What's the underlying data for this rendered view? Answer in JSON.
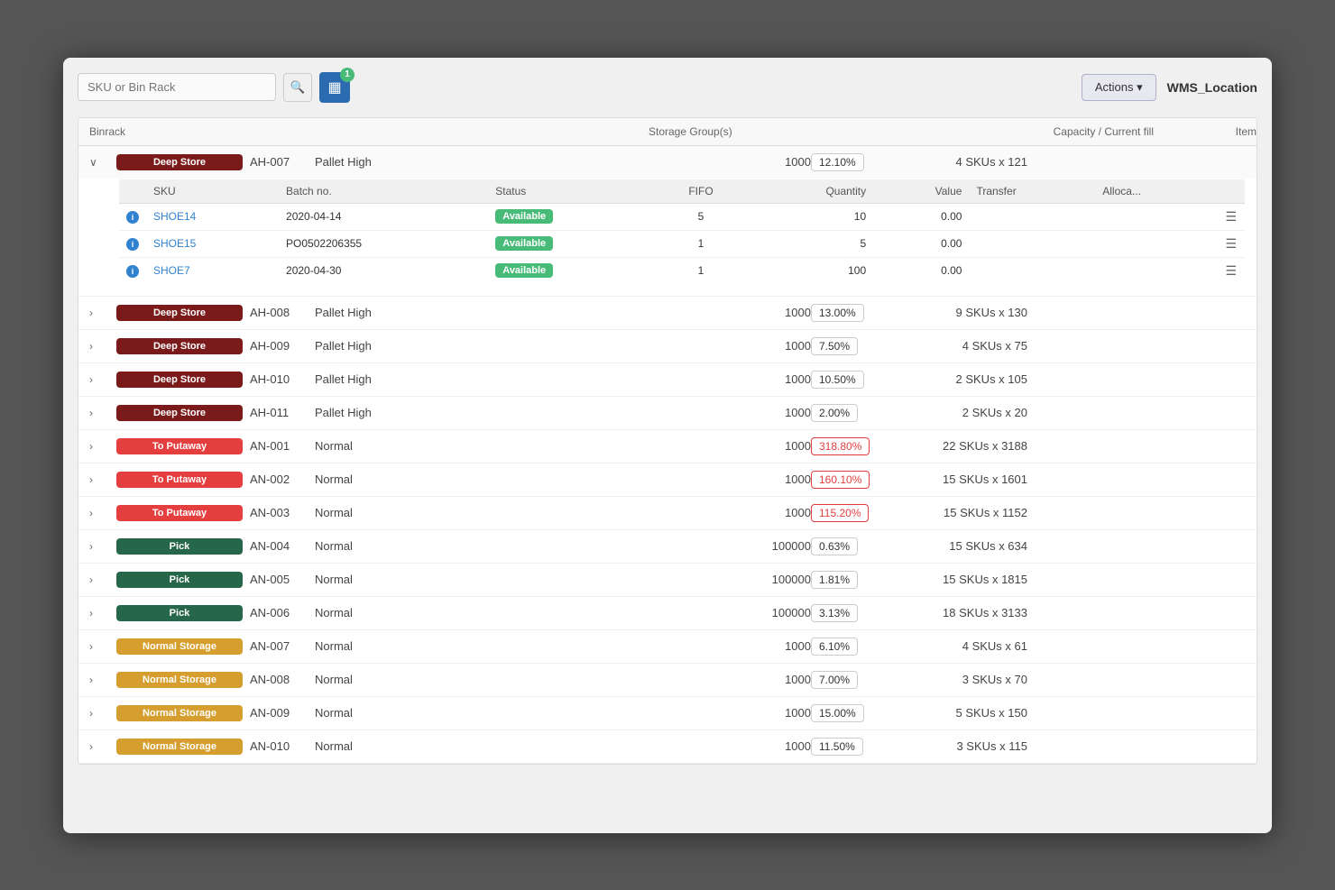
{
  "toolbar": {
    "search_placeholder": "SKU or Bin Rack",
    "filter_badge": "1",
    "actions_label": "Actions ▾",
    "wms_label": "WMS_Location"
  },
  "table": {
    "headers": {
      "binrack": "Binrack",
      "storage_groups": "Storage Group(s)",
      "capacity": "Capacity / Current fill",
      "items": "Items"
    },
    "sub_headers": {
      "sku": "SKU",
      "batch": "Batch no.",
      "status": "Status",
      "fifo": "FIFO",
      "quantity": "Quantity",
      "value": "Value",
      "transfer": "Transfer",
      "alloca": "Alloca..."
    }
  },
  "rows": [
    {
      "expanded": true,
      "tag": "Deep Store",
      "tag_type": "deep",
      "id": "AH-007",
      "storage_group": "Pallet High",
      "capacity": 1000,
      "fill": "12.10%",
      "fill_over": false,
      "items": "4 SKUs x 121",
      "sub_rows": [
        {
          "sku": "SHOE14",
          "batch": "2020-04-14",
          "status": "Available",
          "fifo": 5,
          "quantity": 10,
          "value": "0.00"
        },
        {
          "sku": "SHOE15",
          "batch": "PO0502206355",
          "status": "Available",
          "fifo": 1,
          "quantity": 5,
          "value": "0.00"
        },
        {
          "sku": "SHOE7",
          "batch": "2020-04-30",
          "status": "Available",
          "fifo": 1,
          "quantity": 100,
          "value": "0.00"
        }
      ]
    },
    {
      "expanded": false,
      "tag": "Deep Store",
      "tag_type": "deep",
      "id": "AH-008",
      "storage_group": "Pallet High",
      "capacity": 1000,
      "fill": "13.00%",
      "fill_over": false,
      "items": "9 SKUs x 130"
    },
    {
      "expanded": false,
      "tag": "Deep Store",
      "tag_type": "deep",
      "id": "AH-009",
      "storage_group": "Pallet High",
      "capacity": 1000,
      "fill": "7.50%",
      "fill_over": false,
      "items": "4 SKUs x 75"
    },
    {
      "expanded": false,
      "tag": "Deep Store",
      "tag_type": "deep",
      "id": "AH-010",
      "storage_group": "Pallet High",
      "capacity": 1000,
      "fill": "10.50%",
      "fill_over": false,
      "items": "2 SKUs x 105"
    },
    {
      "expanded": false,
      "tag": "Deep Store",
      "tag_type": "deep",
      "id": "AH-011",
      "storage_group": "Pallet High",
      "capacity": 1000,
      "fill": "2.00%",
      "fill_over": false,
      "items": "2 SKUs x 20"
    },
    {
      "expanded": false,
      "tag": "To Putaway",
      "tag_type": "putaway",
      "id": "AN-001",
      "storage_group": "Normal",
      "capacity": 1000,
      "fill": "318.80%",
      "fill_over": true,
      "items": "22 SKUs x 3188"
    },
    {
      "expanded": false,
      "tag": "To Putaway",
      "tag_type": "putaway",
      "id": "AN-002",
      "storage_group": "Normal",
      "capacity": 1000,
      "fill": "160.10%",
      "fill_over": true,
      "items": "15 SKUs x 1601"
    },
    {
      "expanded": false,
      "tag": "To Putaway",
      "tag_type": "putaway",
      "id": "AN-003",
      "storage_group": "Normal",
      "capacity": 1000,
      "fill": "115.20%",
      "fill_over": true,
      "items": "15 SKUs x 1152"
    },
    {
      "expanded": false,
      "tag": "Pick",
      "tag_type": "pick",
      "id": "AN-004",
      "storage_group": "Normal",
      "capacity": 100000,
      "fill": "0.63%",
      "fill_over": false,
      "items": "15 SKUs x 634"
    },
    {
      "expanded": false,
      "tag": "Pick",
      "tag_type": "pick",
      "id": "AN-005",
      "storage_group": "Normal",
      "capacity": 100000,
      "fill": "1.81%",
      "fill_over": false,
      "items": "15 SKUs x 1815"
    },
    {
      "expanded": false,
      "tag": "Pick",
      "tag_type": "pick",
      "id": "AN-006",
      "storage_group": "Normal",
      "capacity": 100000,
      "fill": "3.13%",
      "fill_over": false,
      "items": "18 SKUs x 3133"
    },
    {
      "expanded": false,
      "tag": "Normal Storage",
      "tag_type": "normal",
      "id": "AN-007",
      "storage_group": "Normal",
      "capacity": 1000,
      "fill": "6.10%",
      "fill_over": false,
      "items": "4 SKUs x 61"
    },
    {
      "expanded": false,
      "tag": "Normal Storage",
      "tag_type": "normal",
      "id": "AN-008",
      "storage_group": "Normal",
      "capacity": 1000,
      "fill": "7.00%",
      "fill_over": false,
      "items": "3 SKUs x 70"
    },
    {
      "expanded": false,
      "tag": "Normal Storage",
      "tag_type": "normal",
      "id": "AN-009",
      "storage_group": "Normal",
      "capacity": 1000,
      "fill": "15.00%",
      "fill_over": false,
      "items": "5 SKUs x 150"
    },
    {
      "expanded": false,
      "tag": "Normal Storage",
      "tag_type": "normal",
      "id": "AN-010",
      "storage_group": "Normal",
      "capacity": 1000,
      "fill": "11.50%",
      "fill_over": false,
      "items": "3 SKUs x 115"
    }
  ]
}
